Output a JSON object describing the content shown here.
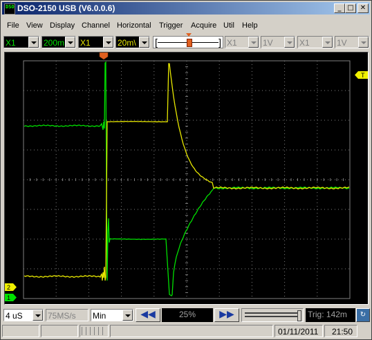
{
  "window": {
    "title": "DSO-2150 USB (V6.0.0.6)",
    "app_icon_text": "DSO",
    "minimize_glyph": "_",
    "maximize_glyph": "□",
    "close_glyph": "✕"
  },
  "menu": [
    "File",
    "View",
    "Display",
    "Channel",
    "Horizontal",
    "Trigger",
    "Acquire",
    "Util",
    "Help"
  ],
  "toolbar": {
    "ch1_probe": "X1",
    "ch1_volts": "200m",
    "ch2_probe": "X1",
    "ch2_volts": "20m\\",
    "ch3_probe": "X1",
    "ch3_volts": "1V",
    "ch4_probe": "X1",
    "ch4_volts": "1V",
    "trigger_bracket_left": "[",
    "trigger_bracket_right": "]"
  },
  "scope": {
    "trigger_marker_label": "T",
    "ch2_marker_label": "2",
    "ch1_marker_label": "1",
    "colors": {
      "ch1": "#00e000",
      "ch2": "#e8e800",
      "grid": "#808080",
      "marker_top": "#e06020"
    }
  },
  "controls": {
    "timebase": "4 uS",
    "sample_rate": "75MS/s",
    "mode": "Min",
    "prev_glyph": "◀◀",
    "position_percent": "25%",
    "next_glyph": "▶▶",
    "trig_label": "Trig: 142m",
    "sample_rate_state": "disabled"
  },
  "status": {
    "date": "01/11/2011",
    "time": "21:50"
  }
}
